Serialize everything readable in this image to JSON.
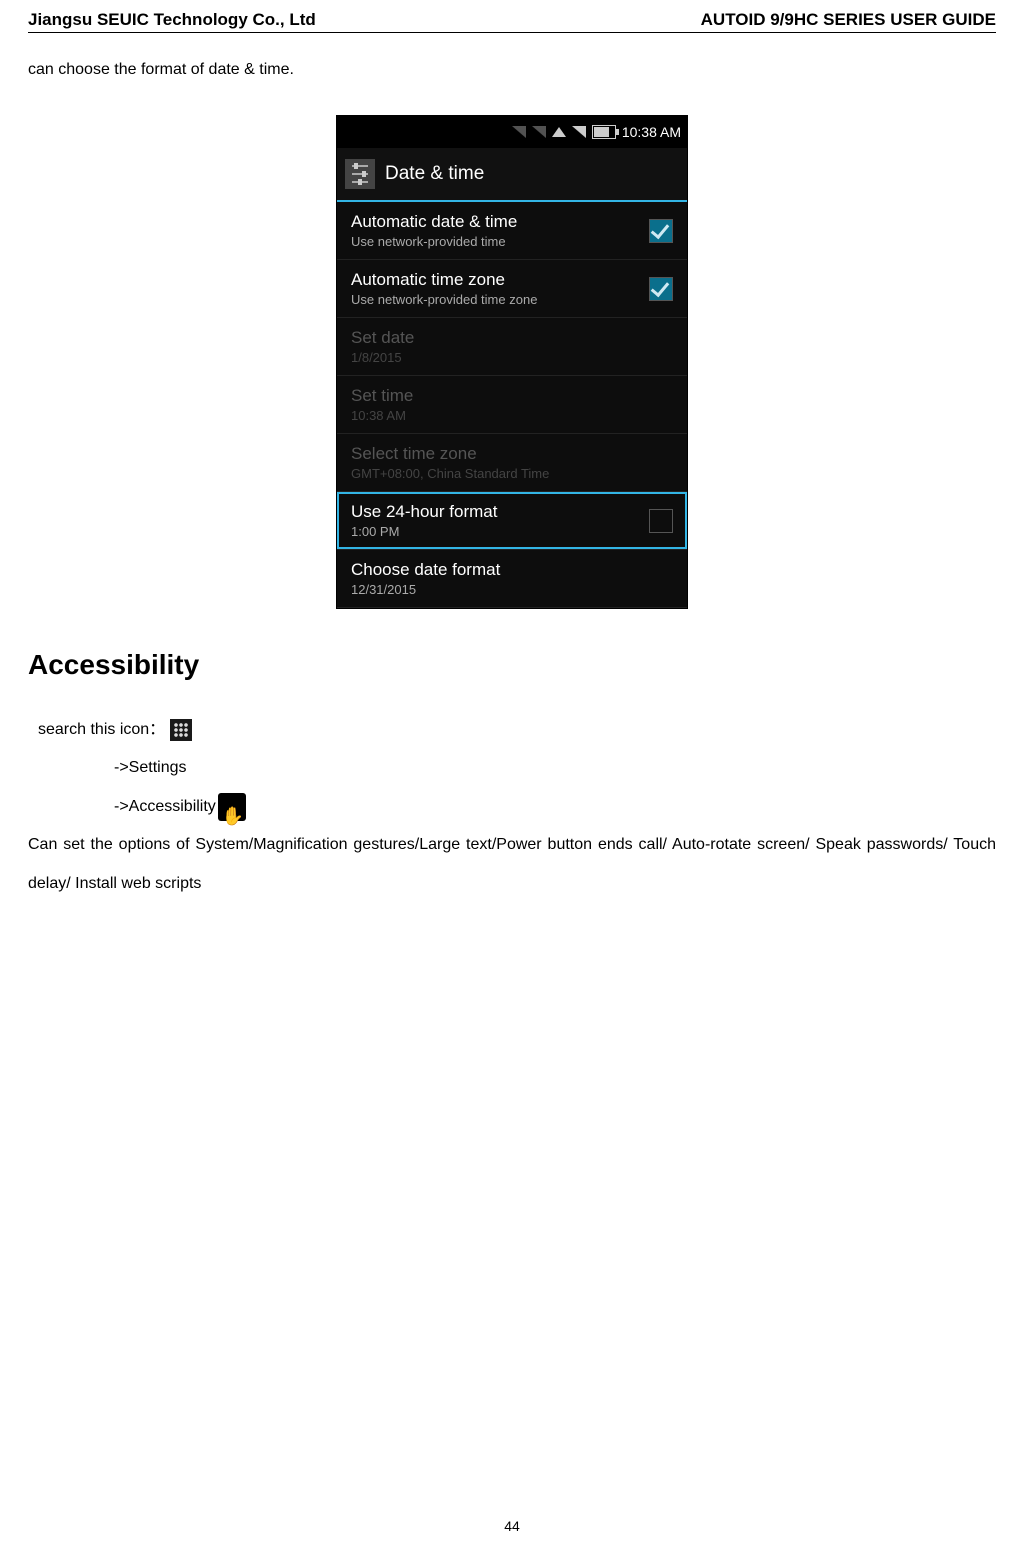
{
  "header": {
    "left": "Jiangsu SEUIC Technology Co., Ltd",
    "right": "AUTOID 9/9HC SERIES USER GUIDE"
  },
  "intro_line": "can choose the format of date & time.",
  "phone": {
    "status_time": "10:38 AM",
    "title": "Date & time",
    "rows": [
      {
        "title": "Automatic date & time",
        "sub": "Use network-provided time",
        "state": "enabled",
        "chk": "checked"
      },
      {
        "title": "Automatic time zone",
        "sub": "Use network-provided time zone",
        "state": "enabled",
        "chk": "checked"
      },
      {
        "title": "Set date",
        "sub": "1/8/2015",
        "state": "disabled",
        "chk": "none"
      },
      {
        "title": "Set time",
        "sub": "10:38 AM",
        "state": "disabled",
        "chk": "none"
      },
      {
        "title": "Select time zone",
        "sub": "GMT+08:00, China Standard Time",
        "state": "disabled",
        "chk": "none"
      },
      {
        "title": "Use 24-hour format",
        "sub": "1:00 PM",
        "state": "enabled",
        "chk": "unchecked",
        "hl": true
      },
      {
        "title": "Choose date format",
        "sub": "12/31/2015",
        "state": "enabled",
        "chk": "none"
      }
    ]
  },
  "section_heading": "Accessibility",
  "steps": {
    "search_label": "search this icon：",
    "nav1": "->Settings",
    "nav2": "->Accessibility"
  },
  "body_para": "Can set the options of System/Magnification gestures/Large text/Power button ends call/ Auto-rotate screen/ Speak passwords/ Touch delay/ Install web scripts",
  "page_number": "44"
}
